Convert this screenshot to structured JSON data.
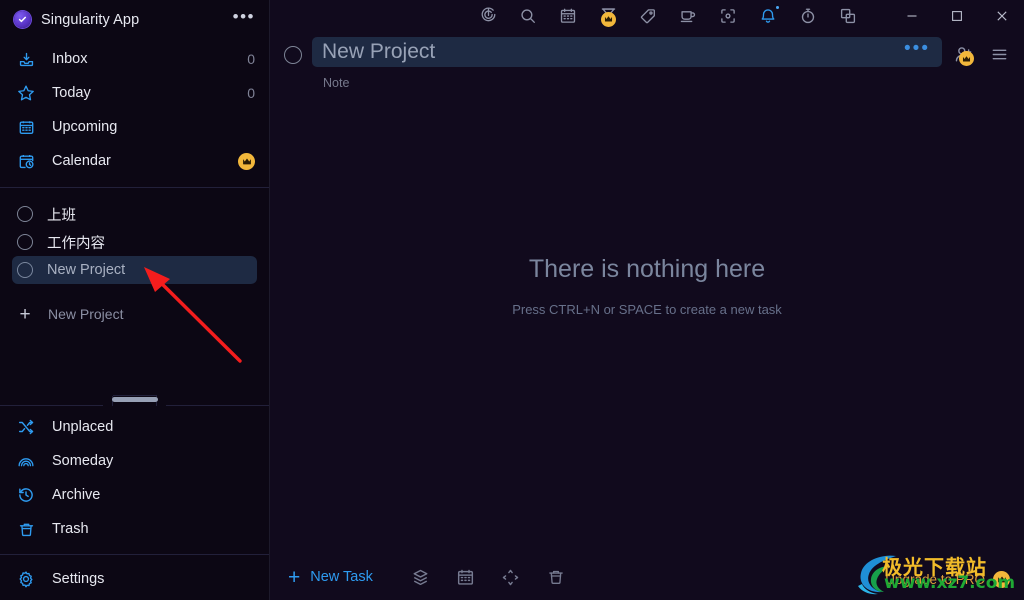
{
  "app": {
    "brand_name": "Singularity App",
    "brand_logo_icon": "check-circle-logo",
    "brand_menu_icon": "ellipsis-icon"
  },
  "sidebar": {
    "nav": [
      {
        "label": "Inbox",
        "icon": "inbox-icon",
        "count": "0",
        "badge": ""
      },
      {
        "label": "Today",
        "icon": "star-icon",
        "count": "0",
        "badge": ""
      },
      {
        "label": "Upcoming",
        "icon": "calendar-icon",
        "count": "",
        "badge": ""
      },
      {
        "label": "Calendar",
        "icon": "calendar-clock-icon",
        "count": "",
        "badge": "crown-icon"
      }
    ],
    "projects": [
      {
        "label": "上班",
        "selected": false
      },
      {
        "label": "工作内容",
        "selected": false
      },
      {
        "label": "New Project",
        "selected": true
      }
    ],
    "new_project": {
      "label": "New Project",
      "icon": "plus-icon"
    },
    "drag_handle_name": "sidebar-resize-handle",
    "bottom_nav": [
      {
        "label": "Unplaced",
        "icon": "shuffle-icon"
      },
      {
        "label": "Someday",
        "icon": "rainbow-icon"
      },
      {
        "label": "Archive",
        "icon": "history-icon"
      },
      {
        "label": "Trash",
        "icon": "trash-icon"
      }
    ],
    "settings": {
      "label": "Settings",
      "icon": "gear-icon"
    }
  },
  "toolbar": {
    "items": [
      {
        "name": "radar-icon",
        "accent": false,
        "pro": false
      },
      {
        "name": "search-icon",
        "accent": false,
        "pro": false
      },
      {
        "name": "calendar-icon",
        "accent": false,
        "pro": false
      },
      {
        "name": "hourglass-icon",
        "accent": false,
        "pro": true
      },
      {
        "name": "tag-icon",
        "accent": false,
        "pro": false
      },
      {
        "name": "coffee-cup-icon",
        "accent": false,
        "pro": false
      },
      {
        "name": "focus-mode-icon",
        "accent": false,
        "pro": false
      },
      {
        "name": "bell-icon",
        "accent": true,
        "pro": false
      },
      {
        "name": "stopwatch-icon",
        "accent": false,
        "pro": false
      },
      {
        "name": "windows-icon",
        "accent": false,
        "pro": false
      }
    ],
    "window_controls": [
      {
        "name": "minimize-button"
      },
      {
        "name": "maximize-button"
      },
      {
        "name": "close-button"
      }
    ]
  },
  "header": {
    "complete_circle_name": "task-complete-circle",
    "title_value": "New Project",
    "title_placeholder": "New Project",
    "title_menu_icon": "ellipsis-icon",
    "note_placeholder": "Note",
    "share_icon": "add-person-icon",
    "share_pro_badge": "crown-icon",
    "menu_icon": "hamburger-menu-icon"
  },
  "main": {
    "empty_title": "There is nothing here",
    "empty_subtitle": "Press CTRL+N or SPACE to create a new task"
  },
  "bottom_bar": {
    "new_task_label": "New Task",
    "new_task_icon": "plus-icon",
    "actions": [
      {
        "name": "layers-icon"
      },
      {
        "name": "calendar-icon"
      },
      {
        "name": "move-icon"
      },
      {
        "name": "trash-icon"
      }
    ],
    "upgrade_label": "Upgrade to PRO",
    "upgrade_icon": "crown-icon"
  },
  "annotation": {
    "arrow_name": "red-pointer-arrow",
    "arrow_color": "#f41d1d"
  },
  "watermark": {
    "site_name": "极光下载站",
    "url": "www.xz7.com",
    "logo_name": "aurora-swirl-logo"
  },
  "colors": {
    "app_bg": "#0f0a19",
    "sidebar_bg": "#0c0714",
    "main_bg": "#110a1d",
    "accent_blue": "#2e9bf0",
    "selection_blue": "#1e2a43",
    "pro_gold": "#f2b73b"
  }
}
